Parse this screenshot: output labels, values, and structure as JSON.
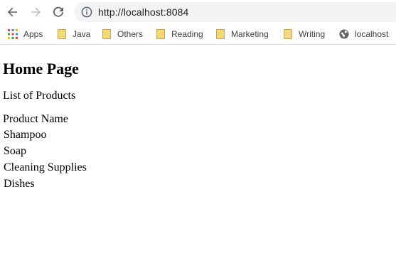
{
  "browser": {
    "url": "http://localhost:8084",
    "bookmarks": [
      {
        "label": "Apps",
        "icon": "apps-grid-icon"
      },
      {
        "label": "Java",
        "icon": "folder-icon"
      },
      {
        "label": "Others",
        "icon": "folder-icon"
      },
      {
        "label": "Reading",
        "icon": "folder-icon"
      },
      {
        "label": "Marketing",
        "icon": "folder-icon"
      },
      {
        "label": "Writing",
        "icon": "folder-icon"
      },
      {
        "label": "localhost",
        "icon": "globe-icon"
      }
    ]
  },
  "page": {
    "title": "Home Page",
    "subtitle": "List of Products",
    "table": {
      "header": "Product Name",
      "rows": [
        "Shampoo",
        "Soap",
        "Cleaning Supplies",
        "Dishes"
      ]
    }
  }
}
